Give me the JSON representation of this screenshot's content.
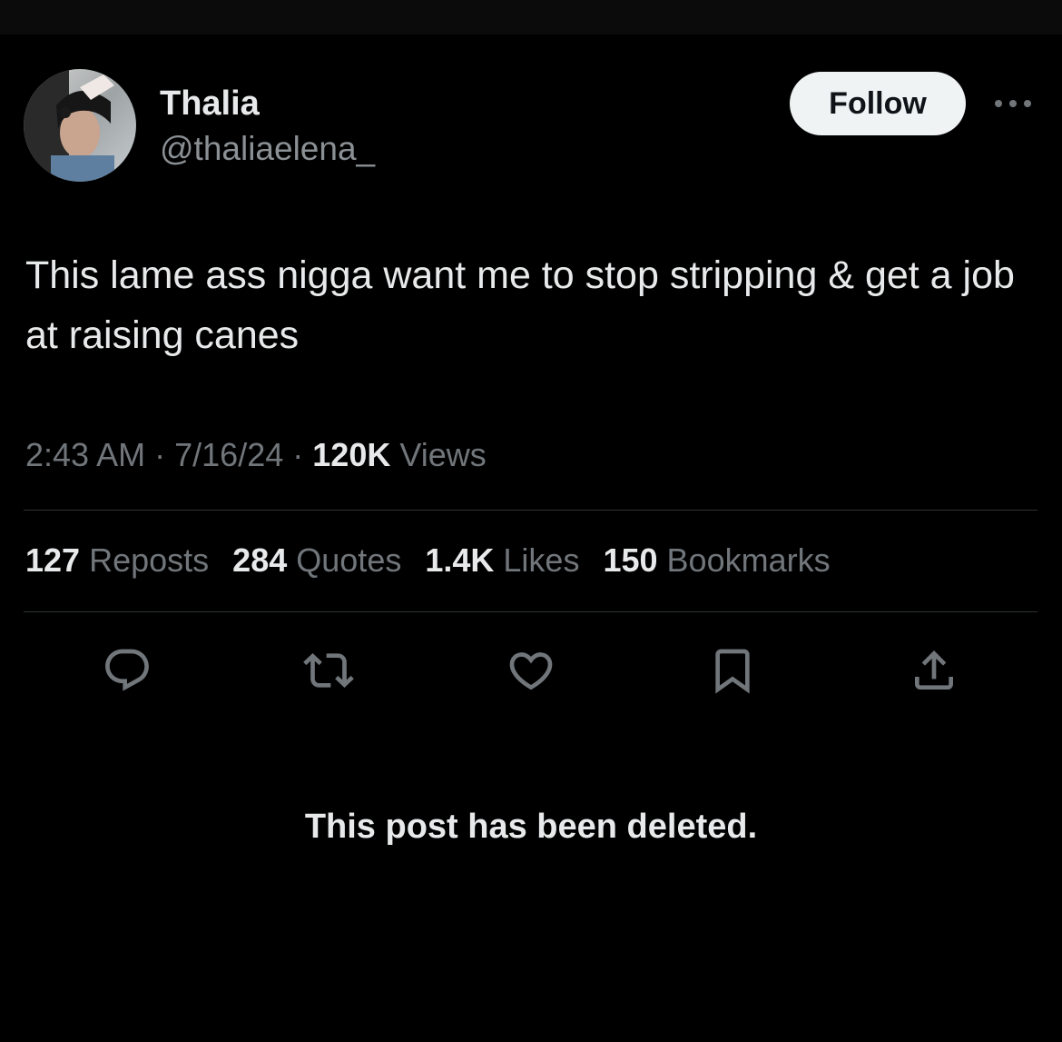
{
  "author": {
    "display_name": "Thalia",
    "handle": "@thaliaelena_",
    "avatar_icon": "profile-photo"
  },
  "follow_button": {
    "label": "Follow"
  },
  "more_menu": {
    "icon": "more-dots-icon"
  },
  "tweet": {
    "text": "This lame ass nigga want me to stop stripping & get a job at raising canes"
  },
  "meta": {
    "time": "2:43 AM",
    "separator": "·",
    "date": "7/16/24",
    "views_count": "120K",
    "views_label": "Views"
  },
  "stats": [
    {
      "count": "127",
      "label": "Reposts"
    },
    {
      "count": "284",
      "label": "Quotes"
    },
    {
      "count": "1.4K",
      "label": "Likes"
    },
    {
      "count": "150",
      "label": "Bookmarks"
    }
  ],
  "actions": [
    {
      "icon": "reply-icon"
    },
    {
      "icon": "repost-icon"
    },
    {
      "icon": "like-heart-icon"
    },
    {
      "icon": "bookmark-icon"
    },
    {
      "icon": "share-icon"
    }
  ],
  "notice": "This post has been deleted.",
  "colors": {
    "background": "#000000",
    "primary_text": "#e7e9ea",
    "secondary_text": "#71767b",
    "divider": "#2f3336",
    "follow_bg": "#eff3f4"
  }
}
